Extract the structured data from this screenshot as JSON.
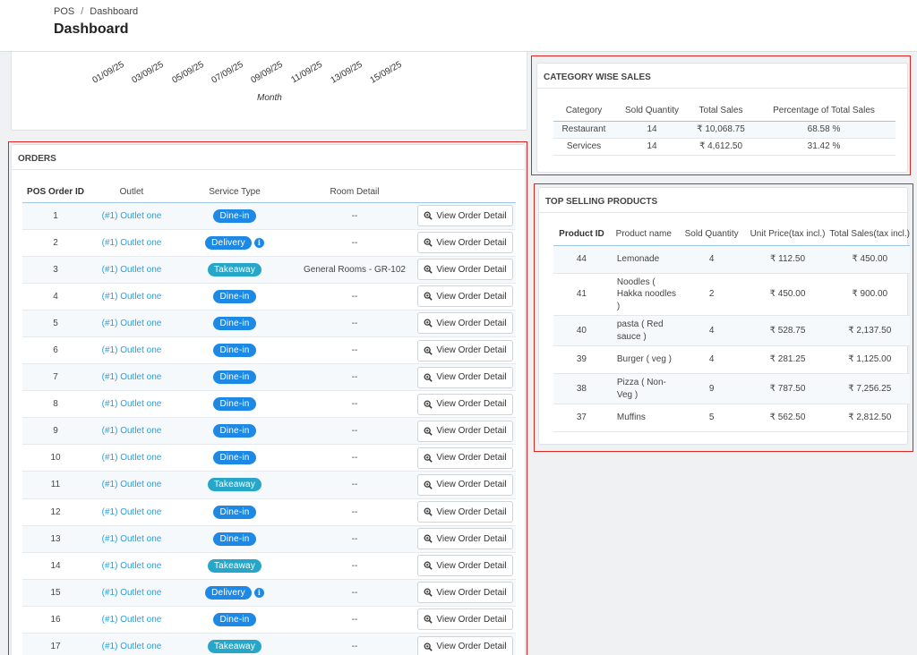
{
  "breadcrumb": {
    "root": "POS",
    "separator": "/",
    "current": "Dashboard"
  },
  "page_title": "Dashboard",
  "chart": {
    "x_ticks": [
      "01/09/25",
      "03/09/25",
      "05/09/25",
      "07/09/25",
      "09/09/25",
      "11/09/25",
      "13/09/25",
      "15/09/25"
    ],
    "x_label": "Month"
  },
  "orders": {
    "title": "ORDERS",
    "columns": [
      "POS Order ID",
      "Outlet",
      "Service Type",
      "Room Detail",
      ""
    ],
    "view_label": "View Order Detail",
    "rows": [
      {
        "id": "1",
        "outlet": "(#1) Outlet one",
        "service": "Dine-in",
        "kind": "dinein",
        "room": "--"
      },
      {
        "id": "2",
        "outlet": "(#1) Outlet one",
        "service": "Delivery",
        "kind": "delivery",
        "room": "--"
      },
      {
        "id": "3",
        "outlet": "(#1) Outlet one",
        "service": "Takeaway",
        "kind": "takeaway",
        "room": "General Rooms - GR-102"
      },
      {
        "id": "4",
        "outlet": "(#1) Outlet one",
        "service": "Dine-in",
        "kind": "dinein",
        "room": "--"
      },
      {
        "id": "5",
        "outlet": "(#1) Outlet one",
        "service": "Dine-in",
        "kind": "dinein",
        "room": "--"
      },
      {
        "id": "6",
        "outlet": "(#1) Outlet one",
        "service": "Dine-in",
        "kind": "dinein",
        "room": "--"
      },
      {
        "id": "7",
        "outlet": "(#1) Outlet one",
        "service": "Dine-in",
        "kind": "dinein",
        "room": "--"
      },
      {
        "id": "8",
        "outlet": "(#1) Outlet one",
        "service": "Dine-in",
        "kind": "dinein",
        "room": "--"
      },
      {
        "id": "9",
        "outlet": "(#1) Outlet one",
        "service": "Dine-in",
        "kind": "dinein",
        "room": "--"
      },
      {
        "id": "10",
        "outlet": "(#1) Outlet one",
        "service": "Dine-in",
        "kind": "dinein",
        "room": "--"
      },
      {
        "id": "11",
        "outlet": "(#1) Outlet one",
        "service": "Takeaway",
        "kind": "takeaway",
        "room": "--"
      },
      {
        "id": "12",
        "outlet": "(#1) Outlet one",
        "service": "Dine-in",
        "kind": "dinein",
        "room": "--"
      },
      {
        "id": "13",
        "outlet": "(#1) Outlet one",
        "service": "Dine-in",
        "kind": "dinein",
        "room": "--"
      },
      {
        "id": "14",
        "outlet": "(#1) Outlet one",
        "service": "Takeaway",
        "kind": "takeaway",
        "room": "--"
      },
      {
        "id": "15",
        "outlet": "(#1) Outlet one",
        "service": "Delivery",
        "kind": "delivery",
        "room": "--"
      },
      {
        "id": "16",
        "outlet": "(#1) Outlet one",
        "service": "Dine-in",
        "kind": "dinein",
        "room": "--"
      },
      {
        "id": "17",
        "outlet": "(#1) Outlet one",
        "service": "Takeaway",
        "kind": "takeaway",
        "room": "--"
      }
    ]
  },
  "category_sales": {
    "title": "CATEGORY WISE SALES",
    "columns": [
      "Category",
      "Sold Quantity",
      "Total Sales",
      "Percentage of Total Sales"
    ],
    "rows": [
      {
        "category": "Restaurant",
        "qty": "14",
        "total": "₹ 10,068.75",
        "pct": "68.58 %"
      },
      {
        "category": "Services",
        "qty": "14",
        "total": "₹ 4,612.50",
        "pct": "31.42 %"
      }
    ]
  },
  "top_products": {
    "title": "TOP SELLING PRODUCTS",
    "columns": [
      "Product ID",
      "Product name",
      "Sold Quantity",
      "Unit Price(tax incl.)",
      "Total Sales(tax incl.)"
    ],
    "rows": [
      {
        "id": "44",
        "name": "Lemonade",
        "qty": "4",
        "unit": "₹ 112.50",
        "total": "₹ 450.00"
      },
      {
        "id": "41",
        "name": "Noodles ( Hakka noodles )",
        "qty": "2",
        "unit": "₹ 450.00",
        "total": "₹ 900.00"
      },
      {
        "id": "40",
        "name": "pasta ( Red sauce )",
        "qty": "4",
        "unit": "₹ 528.75",
        "total": "₹ 2,137.50"
      },
      {
        "id": "39",
        "name": "Burger ( veg )",
        "qty": "4",
        "unit": "₹ 281.25",
        "total": "₹ 1,125.00"
      },
      {
        "id": "38",
        "name": "Pizza ( Non-Veg )",
        "qty": "9",
        "unit": "₹ 787.50",
        "total": "₹ 7,256.25"
      },
      {
        "id": "37",
        "name": "Muffins",
        "qty": "5",
        "unit": "₹ 562.50",
        "total": "₹ 2,812.50"
      }
    ]
  },
  "colors": {
    "accent": "#1e88e5",
    "link": "#2a9fd8",
    "takeaway": "#26a6c8",
    "highlight": "#e02424"
  }
}
